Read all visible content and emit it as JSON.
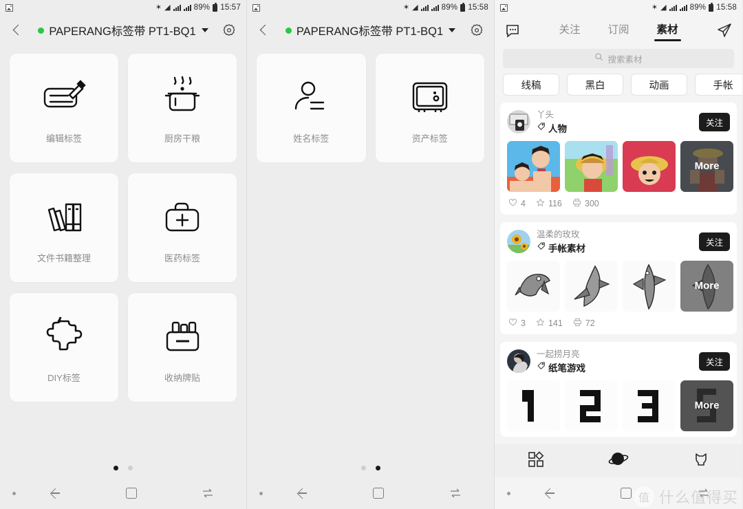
{
  "status_bar": {
    "notification_icon": "image-icon",
    "bluetooth_icon": "bluetooth-icon",
    "wifi_icon": "wifi-icon",
    "signal_icon_1": "signal-bars-icon",
    "signal_icon_2": "signal-bars-icon",
    "battery_percent": "89%",
    "battery_icon": "battery-icon",
    "time_left": "15:57",
    "time_middle": "15:58",
    "time_right": "15:58"
  },
  "panel_a": {
    "header": {
      "back_icon": "back-chevron-icon",
      "status_dot_color": "#28c840",
      "title": "PAPERANG标签带 PT1-BQ1",
      "caret_icon": "chevron-down-icon",
      "settings_icon": "gear-icon"
    },
    "tiles": [
      {
        "label": "编辑标签",
        "icon": "edit-label-icon"
      },
      {
        "label": "厨房干粮",
        "icon": "cooking-pot-icon"
      },
      {
        "label": "文件书籍整理",
        "icon": "books-icon"
      },
      {
        "label": "医药标签",
        "icon": "medical-kit-icon"
      },
      {
        "label": "DIY标签",
        "icon": "puzzle-piece-icon"
      },
      {
        "label": "收纳牌贴",
        "icon": "storage-box-icon"
      }
    ],
    "page_dots": {
      "count": 2,
      "active": 0
    }
  },
  "panel_b": {
    "header": {
      "back_icon": "back-chevron-icon",
      "status_dot_color": "#28c840",
      "title": "PAPERANG标签带 PT1-BQ1",
      "caret_icon": "chevron-down-icon",
      "settings_icon": "gear-icon"
    },
    "tiles": [
      {
        "label": "姓名标签",
        "icon": "person-icon"
      },
      {
        "label": "资产标签",
        "icon": "safe-box-icon"
      }
    ],
    "page_dots": {
      "count": 2,
      "active": 1
    }
  },
  "panel_c": {
    "tabbar": {
      "message_icon": "chat-bubble-icon",
      "send_icon": "send-plane-icon",
      "tabs": [
        {
          "label": "关注",
          "active": false
        },
        {
          "label": "订阅",
          "active": false
        },
        {
          "label": "素材",
          "active": true
        }
      ]
    },
    "search": {
      "icon": "search-icon",
      "placeholder": "搜索素材",
      "value": ""
    },
    "chips": [
      "线稿",
      "黑白",
      "动画",
      "手帐"
    ],
    "follow_label": "关注",
    "more_label": "More",
    "cards": [
      {
        "user": "丫头",
        "tag_icon": "tag-icon",
        "tag": "人物",
        "avatar": "camera-photo-avatar",
        "thumbs": [
          "anime-two-characters",
          "anime-straw-hat-boy",
          "anime-straw-hat-red-bg",
          "anime-boy-dark-bg"
        ],
        "stats": {
          "likes_icon": "heart-icon",
          "likes": "4",
          "favorites_icon": "star-icon",
          "favorites": "116",
          "prints_icon": "printer-icon",
          "prints": "300"
        }
      },
      {
        "user": "温柔的玫玫",
        "tag_icon": "tag-icon",
        "tag": "手帐素材",
        "avatar": "sunflower-avatar",
        "thumbs": [
          "fish-engraving-1",
          "fish-engraving-2",
          "fish-engraving-3",
          "fish-engraving-4"
        ],
        "stats": {
          "likes_icon": "heart-icon",
          "likes": "3",
          "favorites_icon": "star-icon",
          "favorites": "141",
          "prints_icon": "printer-icon",
          "prints": "72"
        }
      },
      {
        "user": "一起捞月亮",
        "tag_icon": "tag-icon",
        "tag": "纸笔游戏",
        "avatar": "portrait-avatar",
        "thumbs": [
          "pixel-number-1",
          "pixel-number-2",
          "pixel-number-3",
          "pixel-number-5"
        ],
        "stats": null
      }
    ],
    "bottom_nav": [
      {
        "icon": "grid-apps-icon",
        "active": false
      },
      {
        "icon": "planet-icon",
        "active": true
      },
      {
        "icon": "cat-profile-icon",
        "active": false
      }
    ]
  },
  "android_nav": {
    "dot_icon": "nav-dot-icon",
    "back_icon": "nav-back-icon",
    "home_icon": "nav-home-icon",
    "recents_icon": "nav-recents-icon"
  },
  "watermark": {
    "badge_text": "值",
    "text": "什么值得买"
  }
}
